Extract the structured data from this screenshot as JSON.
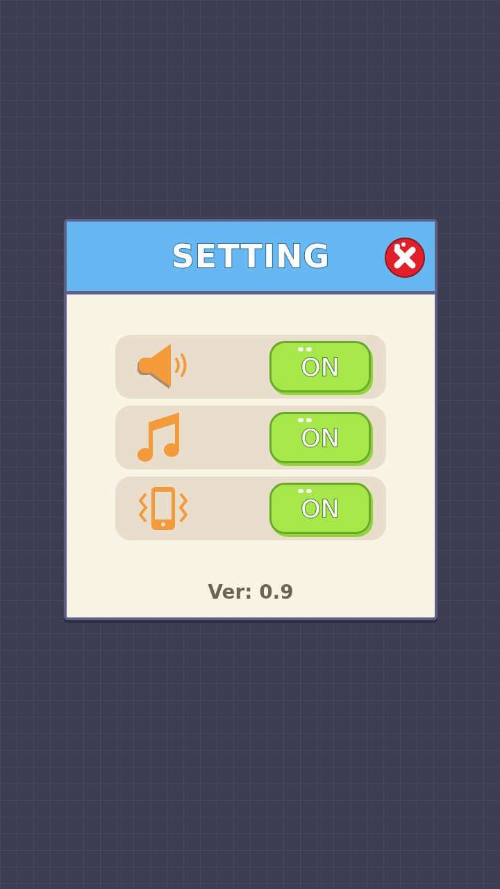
{
  "dialog": {
    "title": "SETTING"
  },
  "settings": [
    {
      "kind": "sound",
      "toggle": "ON",
      "on": true
    },
    {
      "kind": "music",
      "toggle": "ON",
      "on": true
    },
    {
      "kind": "vibration",
      "toggle": "ON",
      "on": true
    }
  ],
  "version": "Ver: 0.9"
}
